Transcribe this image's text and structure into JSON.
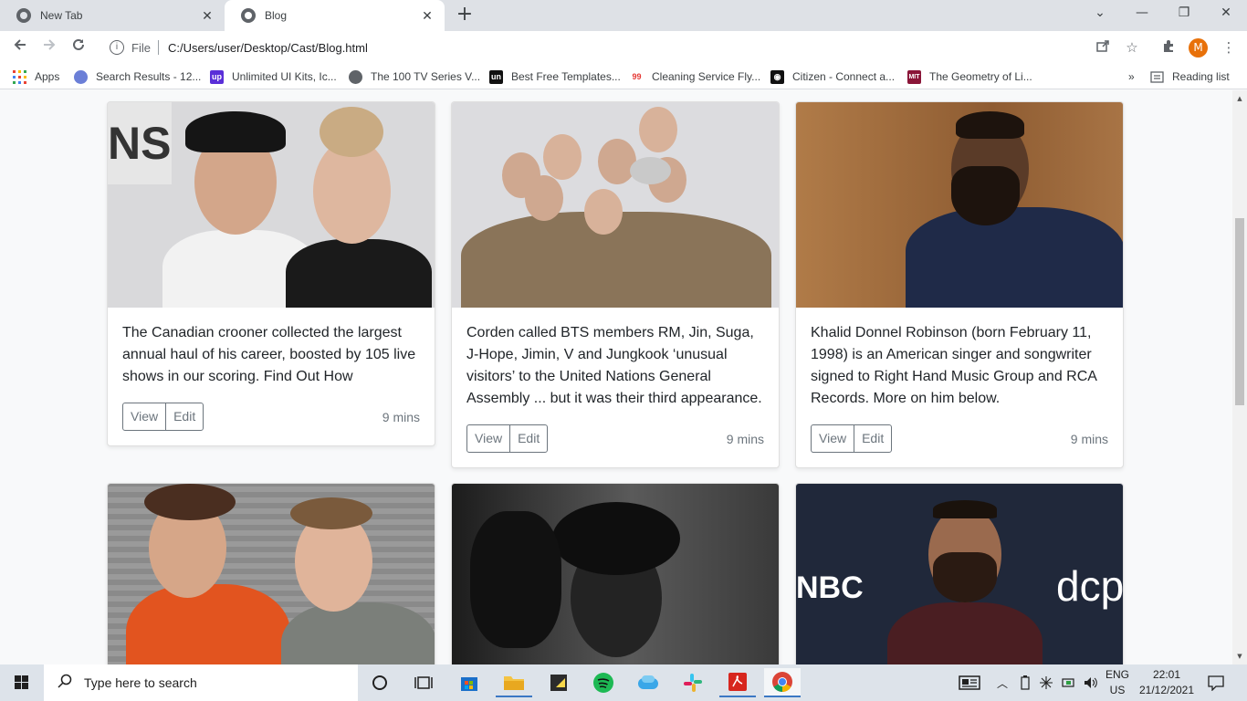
{
  "browser": {
    "tabs": [
      {
        "title": "New Tab",
        "active": false
      },
      {
        "title": "Blog",
        "active": true
      }
    ],
    "new_tab_symbol": "+",
    "close_symbol": "✕",
    "window_controls": {
      "collapse": "⌄",
      "minimize": "—",
      "restore": "❐",
      "close": "✕"
    },
    "address": {
      "scheme": "File",
      "path": "C:/Users/user/Desktop/Cast/Blog.html",
      "info_icon": "i"
    },
    "profile_initial": "M",
    "bookmarks": [
      {
        "label": "Apps",
        "icon": "apps-grid-icon",
        "color": "#ea4335"
      },
      {
        "label": "Search Results - 12...",
        "icon": "123-icon",
        "color": "#6b7fd7"
      },
      {
        "label": "Unlimited UI Kits, Ic...",
        "icon": "up-icon",
        "color": "#5a2fd8"
      },
      {
        "label": "The 100 TV Series V...",
        "icon": "globe-icon",
        "color": "#5f6368"
      },
      {
        "label": "Best Free Templates...",
        "icon": "un-icon",
        "color": "#111111"
      },
      {
        "label": "Cleaning Service Fly...",
        "icon": "99-icon",
        "color": "#e53935"
      },
      {
        "label": "Citizen - Connect a...",
        "icon": "citizen-icon",
        "color": "#111111"
      },
      {
        "label": "The Geometry of Li...",
        "icon": "mit-icon",
        "color": "#8a1538"
      }
    ],
    "more_bookmarks": "»",
    "reading_list": "Reading list"
  },
  "cards": [
    {
      "text": "The Canadian crooner collected the largest annual haul of his career, boosted by 105 live shows in our scoring. Find Out How",
      "view_label": "View",
      "edit_label": "Edit",
      "time": "9 mins",
      "photo_bg": "#d9d9db"
    },
    {
      "text": "Corden called BTS members RM, Jin, Suga, J-Hope, Jimin, V and Jungkook ‘unusual visitors’ to the United Nations General Assembly ... but it was their third appearance.",
      "view_label": "View",
      "edit_label": "Edit",
      "time": "9 mins",
      "photo_bg": "#dcdcdf"
    },
    {
      "text": "Khalid Donnel Robinson (born February 11, 1998) is an American singer and songwriter signed to Right Hand Music Group and RCA Records. More on him below.",
      "view_label": "View",
      "edit_label": "Edit",
      "time": "9 mins",
      "photo_bg": "#9a6a3e"
    },
    {
      "photo_bg": "#8c8c8c"
    },
    {
      "photo_bg": "#4a4a4a"
    },
    {
      "photo_bg": "#20283a",
      "logo_text": "NBC",
      "banner_text": "dcp"
    }
  ],
  "taskbar": {
    "search_placeholder": "Type here to search",
    "language_top": "ENG",
    "language_bottom": "US",
    "time": "22:01",
    "date": "21/12/2021"
  }
}
